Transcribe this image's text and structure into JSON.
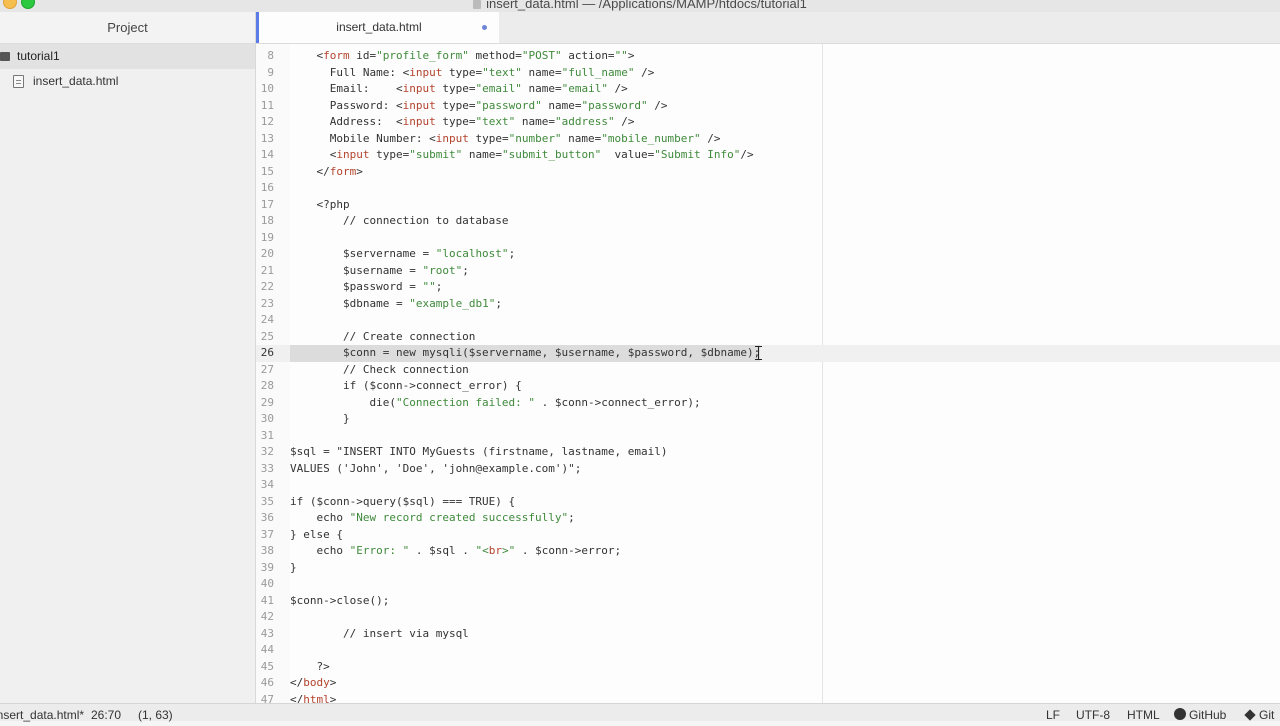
{
  "window": {
    "title": "insert_data.html — /Applications/MAMP/htdocs/tutorial1"
  },
  "sidebar": {
    "title": "Project",
    "root_folder": "tutorial1",
    "files": [
      "insert_data.html"
    ]
  },
  "tabs": [
    {
      "label": "insert_data.html",
      "modified": true
    }
  ],
  "editor": {
    "current_line": 26,
    "lines": [
      {
        "n": "8",
        "t": "    <form id=\"profile_form\" method=\"POST\" action=\"\">"
      },
      {
        "n": "9",
        "t": "      Full Name: <input type=\"text\" name=\"full_name\" />"
      },
      {
        "n": "10",
        "t": "      Email:    <input type=\"email\" name=\"email\" />"
      },
      {
        "n": "11",
        "t": "      Password: <input type=\"password\" name=\"password\" />"
      },
      {
        "n": "12",
        "t": "      Address:  <input type=\"text\" name=\"address\" />"
      },
      {
        "n": "13",
        "t": "      Mobile Number: <input type=\"number\" name=\"mobile_number\" />"
      },
      {
        "n": "14",
        "t": "      <input type=\"submit\" name=\"submit_button\"  value=\"Submit Info\"/>"
      },
      {
        "n": "15",
        "t": "    </form>"
      },
      {
        "n": "16",
        "t": ""
      },
      {
        "n": "17",
        "t": "    <?php"
      },
      {
        "n": "18",
        "t": "        // connection to database"
      },
      {
        "n": "19",
        "t": ""
      },
      {
        "n": "20",
        "t": "        $servername = \"localhost\";"
      },
      {
        "n": "21",
        "t": "        $username = \"root\";"
      },
      {
        "n": "22",
        "t": "        $password = \"\";"
      },
      {
        "n": "23",
        "t": "        $dbname = \"example_db1\";"
      },
      {
        "n": "24",
        "t": ""
      },
      {
        "n": "25",
        "t": "        // Create connection"
      },
      {
        "n": "26",
        "t": "        $conn = new mysqli($servername, $username, $password, $dbname);"
      },
      {
        "n": "27",
        "t": "        // Check connection"
      },
      {
        "n": "28",
        "t": "        if ($conn->connect_error) {"
      },
      {
        "n": "29",
        "t": "            die(\"Connection failed: \" . $conn->connect_error);"
      },
      {
        "n": "30",
        "t": "        }"
      },
      {
        "n": "31",
        "t": ""
      },
      {
        "n": "32",
        "t": "$sql = \"INSERT INTO MyGuests (firstname, lastname, email)"
      },
      {
        "n": "33",
        "t": "VALUES ('John', 'Doe', 'john@example.com')\";"
      },
      {
        "n": "34",
        "t": ""
      },
      {
        "n": "35",
        "t": "if ($conn->query($sql) === TRUE) {"
      },
      {
        "n": "36",
        "t": "    echo \"New record created successfully\";"
      },
      {
        "n": "37",
        "t": "} else {"
      },
      {
        "n": "38",
        "t": "    echo \"Error: \" . $sql . \"<br>\" . $conn->error;"
      },
      {
        "n": "39",
        "t": "}"
      },
      {
        "n": "40",
        "t": ""
      },
      {
        "n": "41",
        "t": "$conn->close();"
      },
      {
        "n": "42",
        "t": ""
      },
      {
        "n": "43",
        "t": "        // insert via mysql"
      },
      {
        "n": "44",
        "t": ""
      },
      {
        "n": "45",
        "t": "    ?>"
      },
      {
        "n": "46",
        "t": "</body>"
      },
      {
        "n": "47",
        "t": "</html>"
      }
    ]
  },
  "statusbar": {
    "file": "insert_data.html*",
    "cursor": "26:70",
    "selection": "(1, 63)",
    "line_ending": "LF",
    "encoding": "UTF-8",
    "grammar": "HTML",
    "github": "GitHub",
    "git": "Git"
  },
  "colors": {
    "tab_accent": "#5b7be6",
    "tag": "#b4442e",
    "string": "#3f8a3b"
  }
}
